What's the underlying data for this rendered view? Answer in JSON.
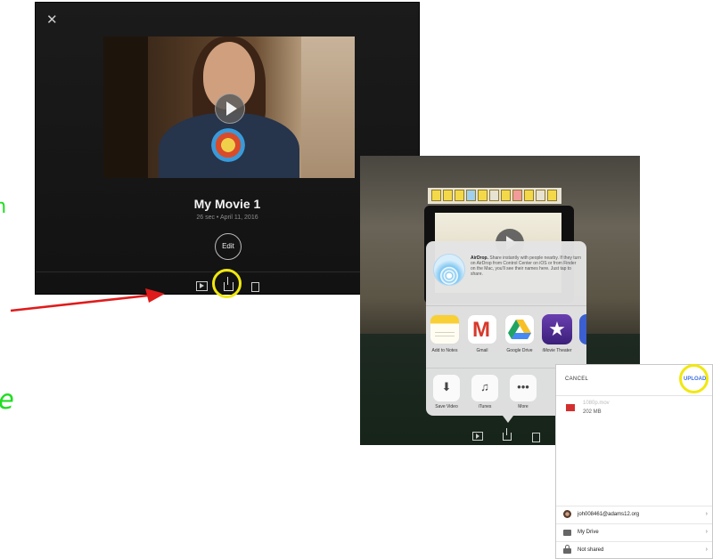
{
  "colors": {
    "highlight": "#f1e80f",
    "arrow": "#e01b1b",
    "fragment_text": "#22dd22",
    "upload_accent": "#3c6ee0"
  },
  "fragments": {
    "left_top": "n",
    "left_bottom": "e"
  },
  "imovie": {
    "close_icon": "close-icon",
    "movie_title": "My Movie 1",
    "movie_meta": "26 sec • April 11, 2016",
    "edit_label": "Edit",
    "toolbar_icons": [
      "play-icon",
      "share-icon",
      "trash-icon"
    ]
  },
  "share_sheet": {
    "airdrop_title": "AirDrop.",
    "airdrop_text": "Share instantly with people nearby. If they turn on AirDrop from Control Center on iOS or from Finder on the Mac, you'll see their names here. Just tap to share.",
    "apps": [
      {
        "label": "Add to Notes",
        "icon": "notes-icon"
      },
      {
        "label": "Gmail",
        "icon": "gmail-icon"
      },
      {
        "label": "Google Drive",
        "icon": "google-drive-icon"
      },
      {
        "label": "iMovie Theater",
        "icon": "imovie-theater-icon"
      }
    ],
    "actions": [
      {
        "label": "Save Video",
        "icon": "save-video-icon",
        "glyph": "⬇"
      },
      {
        "label": "iTunes",
        "icon": "itunes-icon",
        "glyph": "♫"
      },
      {
        "label": "More",
        "icon": "more-icon",
        "glyph": "•••"
      }
    ]
  },
  "drive_upload": {
    "cancel_label": "CANCEL",
    "upload_label": "UPLOAD",
    "file_name": "1080p.mov",
    "file_size": "202 MB",
    "rows": [
      {
        "label": "joh008461@adams12.org",
        "icon": "account-avatar-icon"
      },
      {
        "label": "My Drive",
        "icon": "folder-icon"
      },
      {
        "label": "Not shared",
        "icon": "lock-icon"
      }
    ]
  }
}
